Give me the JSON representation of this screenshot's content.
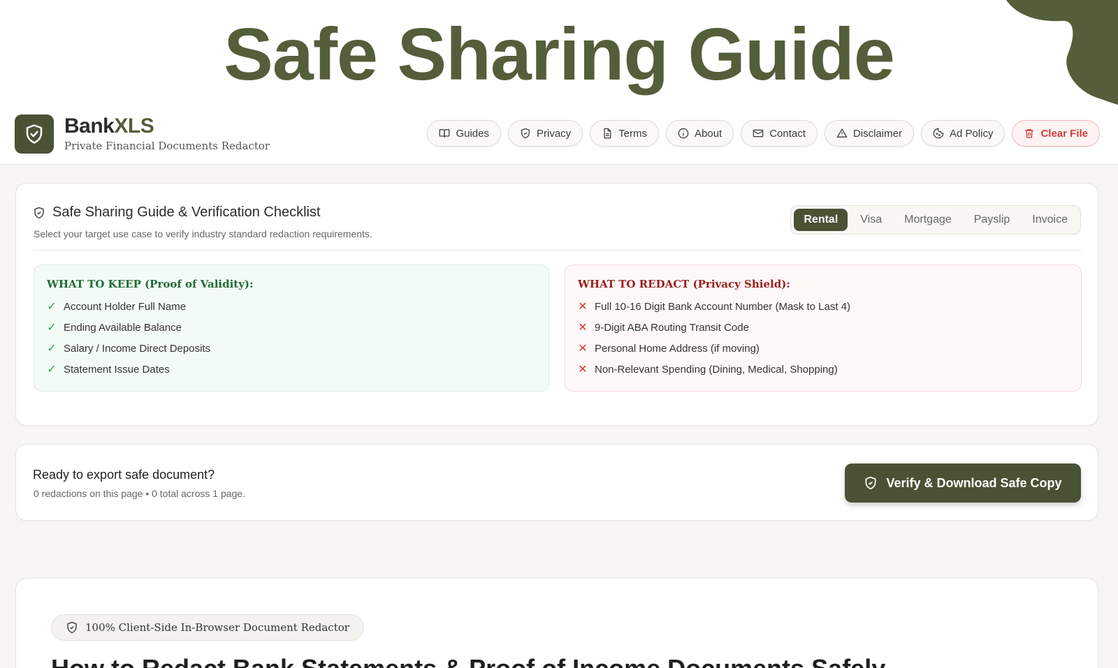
{
  "banner": {
    "title": "Safe Sharing Guide"
  },
  "brand": {
    "name_part1": "Bank",
    "name_part2": "XLS",
    "subtitle": "Private Financial Documents Redactor"
  },
  "nav": [
    {
      "label": "Guides",
      "icon": "book-icon"
    },
    {
      "label": "Privacy",
      "icon": "shield-icon"
    },
    {
      "label": "Terms",
      "icon": "document-icon"
    },
    {
      "label": "About",
      "icon": "info-icon"
    },
    {
      "label": "Contact",
      "icon": "mail-icon"
    },
    {
      "label": "Disclaimer",
      "icon": "warning-icon"
    },
    {
      "label": "Ad Policy",
      "icon": "cookie-icon"
    }
  ],
  "clear_file": {
    "label": "Clear File",
    "icon": "trash-icon"
  },
  "checklist": {
    "title": "Safe Sharing Guide & Verification Checklist",
    "subtitle": "Select your target use case to verify industry standard redaction requirements.",
    "tabs": [
      "Rental",
      "Visa",
      "Mortgage",
      "Payslip",
      "Invoice"
    ],
    "active_tab": "Rental",
    "keep": {
      "heading": "WHAT TO KEEP (Proof of Validity):",
      "items": [
        "Account Holder Full Name",
        "Ending Available Balance",
        "Salary / Income Direct Deposits",
        "Statement Issue Dates"
      ]
    },
    "redact": {
      "heading": "WHAT TO REDACT (Privacy Shield):",
      "items": [
        "Full 10-16 Digit Bank Account Number (Mask to Last 4)",
        "9-Digit ABA Routing Transit Code",
        "Personal Home Address (if moving)",
        "Non-Relevant Spending (Dining, Medical, Shopping)"
      ]
    }
  },
  "export": {
    "title": "Ready to export safe document?",
    "status": "0 redactions on this page • 0 total across 1 page.",
    "button_label": "Verify & Download Safe Copy"
  },
  "article": {
    "badge": "100% Client-Side In-Browser Document Redactor",
    "heading": "How to Redact Bank Statements & Proof of Income Documents Safely"
  },
  "colors": {
    "brand": "#4a5235",
    "title": "#545e3a",
    "keep": "#2f9a4d",
    "redact": "#d43838",
    "danger": "#d03c3c"
  }
}
